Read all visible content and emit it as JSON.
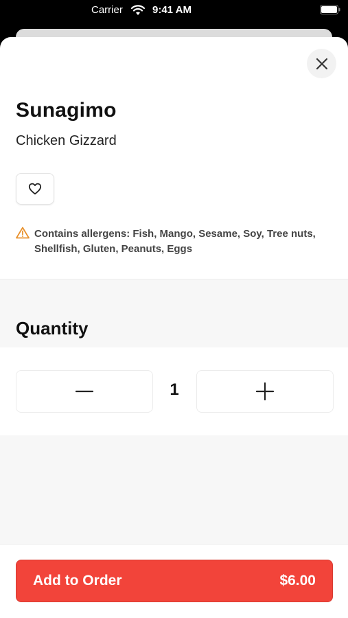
{
  "status_bar": {
    "carrier": "Carrier",
    "time": "9:41 AM"
  },
  "item": {
    "name": "Sunagimo",
    "description": "Chicken Gizzard",
    "allergen_note": "Contains allergens: Fish, Mango, Sesame, Soy, Tree nuts, Shellfish, Gluten, Peanuts, Eggs"
  },
  "quantity": {
    "section_title": "Quantity",
    "value": "1"
  },
  "order_button": {
    "label": "Add to Order",
    "price": "$6.00",
    "color": "#f2443a"
  },
  "icons": {
    "close": "close-icon",
    "favorite": "heart-icon",
    "warning": "warning-icon",
    "decrement": "minus-icon",
    "increment": "plus-icon"
  },
  "colors": {
    "accent": "#f2443a",
    "warning": "#e8912d"
  }
}
